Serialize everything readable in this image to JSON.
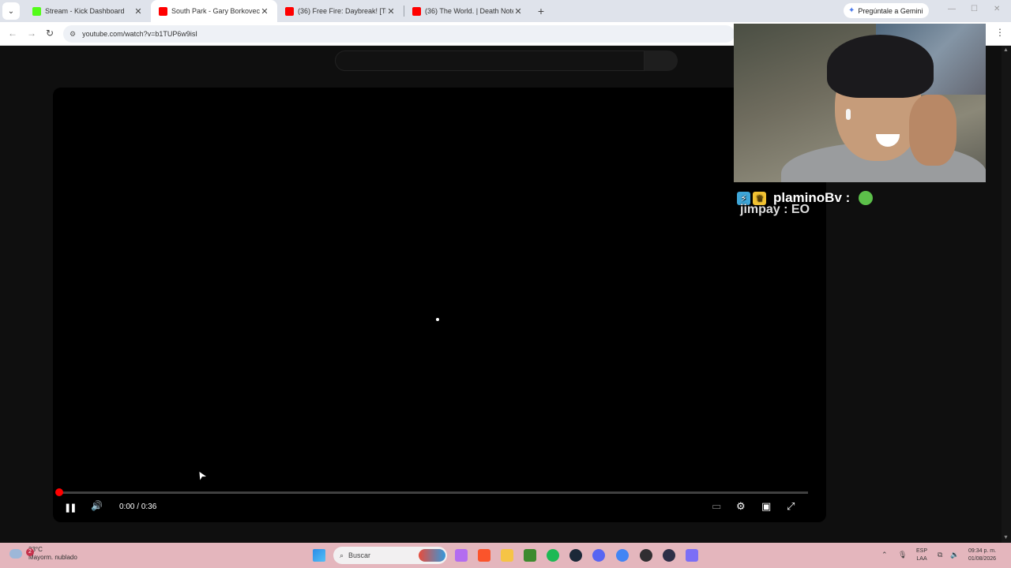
{
  "tabs": [
    {
      "title": "Stream - Kick Dashboard",
      "favicon_color": "#53fc18",
      "active": false
    },
    {
      "title": "South Park - Gary Borkovec's D",
      "favicon_color": "#ff0000",
      "active": true
    },
    {
      "title": "(36) Free Fire: Daybreak! [Tráile",
      "favicon_color": "#ff0000",
      "active": false
    },
    {
      "title": "(36) The World. | Death Note O",
      "favicon_color": "#ff0000",
      "active": false
    }
  ],
  "icons": {
    "tab_menu": "chevron-down-icon",
    "tab_close": "close-icon",
    "new_tab": "plus-icon",
    "back": "arrow-left-icon",
    "forward": "arrow-right-icon",
    "reload": "reload-icon",
    "site_info": "tune-icon",
    "menu": "kebab-icon"
  },
  "glyphs": {
    "tab_menu": "⌄",
    "close": "✕",
    "new_tab": "+",
    "back": "←",
    "forward": "→",
    "reload": "↻",
    "tune": "⚙",
    "kebab": "⋮",
    "minimize": "—",
    "maximize": "☐",
    "win_close": "✕",
    "gemini_star": "✦",
    "pause": "❚❚",
    "volume": "🔊",
    "subtitles": "▭",
    "settings": "⚙",
    "theater": "▣",
    "fullscreen": "⤢",
    "cursor": "➤",
    "search": "⌕",
    "badge_1": "⚡",
    "badge_2": "♛",
    "scroll_up": "▲",
    "scroll_down": "▼",
    "tray_up": "⌃",
    "mic": "🎙",
    "display": "⧉",
    "speaker": "🔉"
  },
  "gemini": {
    "label": "Pregúntale a Gemini"
  },
  "address_bar": {
    "url": "youtube.com/watch?v=b1TUP6w9isI"
  },
  "player": {
    "time_current": "0:00",
    "time_separator": " / ",
    "time_total": "0:36",
    "progress": 0.0,
    "state": "playing"
  },
  "chat": {
    "line1_user": "plaminoBv :",
    "line2": "jimpay : EO"
  },
  "taskbar": {
    "weather_temp": "23°C",
    "weather_desc": "Mayorm. nublado",
    "notif_count": "2",
    "search_label": "Buscar",
    "lang_top": "ESP",
    "lang_bottom": "LAA",
    "time": "09:34 p. m.",
    "date": "01/08/2026",
    "apps": [
      {
        "name": "copilot-icon",
        "color": "#b36cf0"
      },
      {
        "name": "brave-icon",
        "color": "#fb542b"
      },
      {
        "name": "file-explorer-icon",
        "color": "#f6c445"
      },
      {
        "name": "minecraft-icon",
        "color": "#3c8a2e"
      },
      {
        "name": "spotify-icon",
        "color": "#1db954"
      },
      {
        "name": "steam-icon",
        "color": "#1b2838"
      },
      {
        "name": "discord-icon",
        "color": "#5865f2"
      },
      {
        "name": "chrome-icon",
        "color": "#4285f4"
      },
      {
        "name": "obs-icon",
        "color": "#302e31"
      },
      {
        "name": "app-icon",
        "color": "#2d2f48"
      },
      {
        "name": "app-icon-2",
        "color": "#7b6ef6"
      }
    ]
  },
  "colors": {
    "youtube_red": "#ff0000",
    "taskbar_bg": "#e4b6bd",
    "page_bg": "#0f0f0f"
  }
}
